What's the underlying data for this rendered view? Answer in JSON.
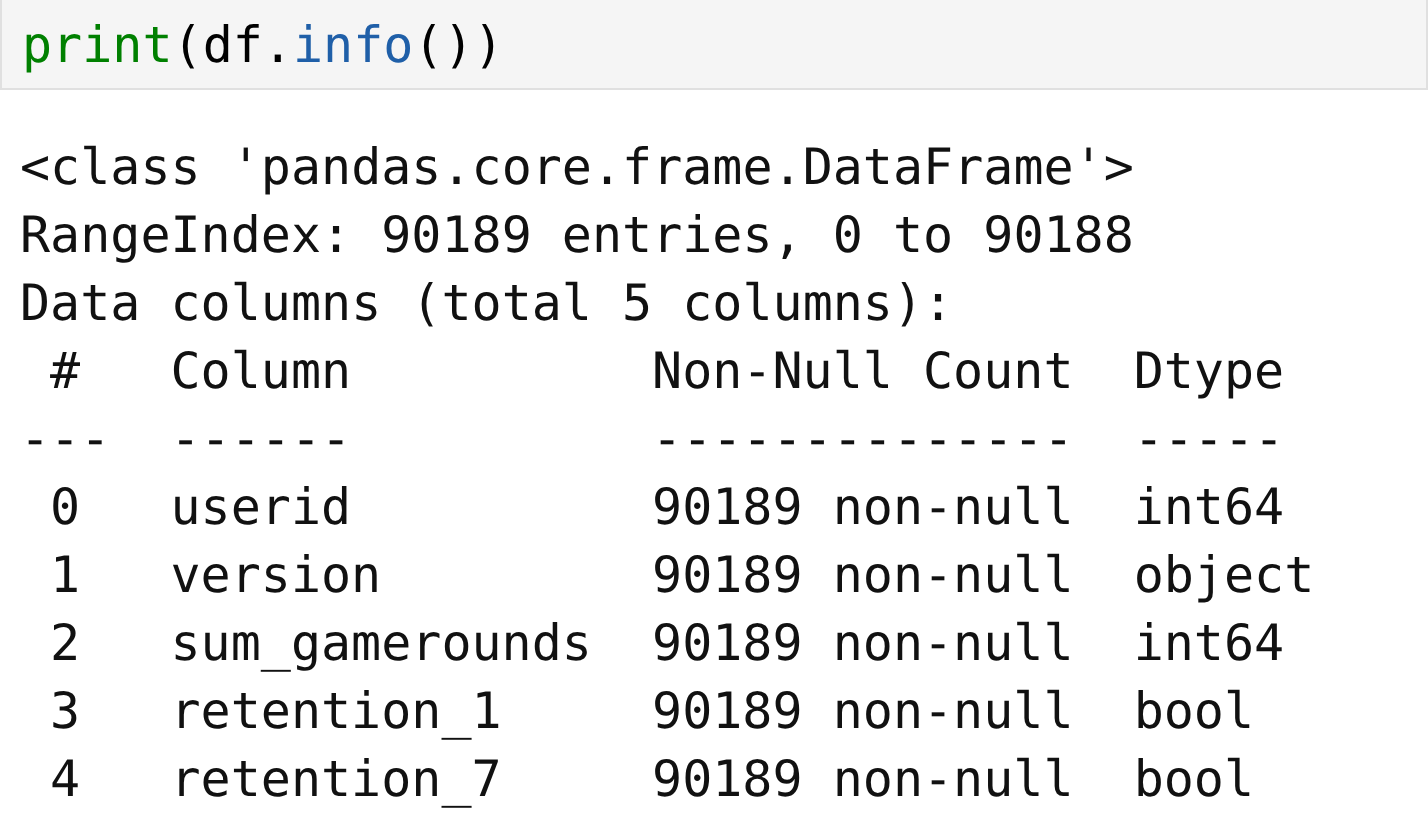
{
  "code_cell": {
    "tokens": [
      {
        "text": "print",
        "kind": "builtin"
      },
      {
        "text": "(df.",
        "kind": "plain"
      },
      {
        "text": "info",
        "kind": "attribute"
      },
      {
        "text": "())",
        "kind": "plain"
      }
    ]
  },
  "output": {
    "lines": [
      "<class 'pandas.core.frame.DataFrame'>",
      "RangeIndex: 90189 entries, 0 to 90188",
      "Data columns (total 5 columns):"
    ],
    "table": {
      "columns": [
        "#",
        "Column",
        "Non-Null Count",
        "Dtype"
      ],
      "separators": [
        "---",
        "------",
        "--------------",
        "-----"
      ],
      "rows": [
        [
          "0",
          "userid",
          "90189 non-null",
          "int64"
        ],
        [
          "1",
          "version",
          "90189 non-null",
          "object"
        ],
        [
          "2",
          "sum_gamerounds",
          "90189 non-null",
          "int64"
        ],
        [
          "3",
          "retention_1",
          "90189 non-null",
          "bool"
        ],
        [
          "4",
          "retention_7",
          "90189 non-null",
          "bool"
        ]
      ]
    }
  }
}
